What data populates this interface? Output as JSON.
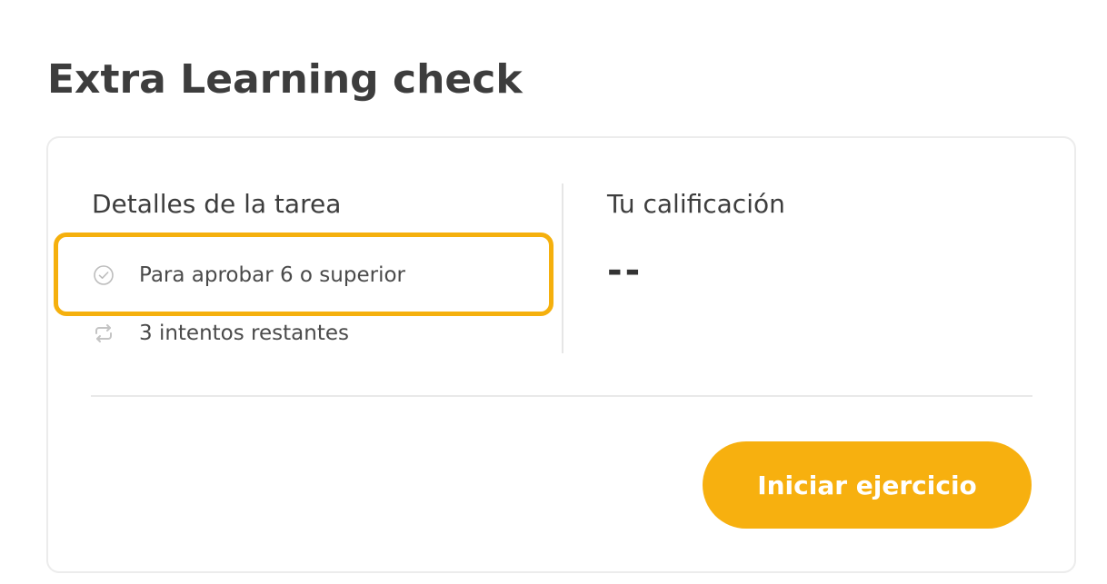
{
  "page": {
    "title": "Extra Learning check"
  },
  "details": {
    "heading": "Detalles de la tarea",
    "items": [
      {
        "icon": "check-circle-icon",
        "text": "Para aprobar 6 o superior"
      },
      {
        "icon": "repeat-icon",
        "text": "3 intentos restantes"
      }
    ]
  },
  "grade": {
    "heading": "Tu calificación",
    "value": "--"
  },
  "actions": {
    "start_label": "Iniciar ejercicio"
  },
  "colors": {
    "accent": "#f7b00f",
    "highlight": "#f5b00d",
    "icon": "#bdbdbd",
    "text": "#3d3d3d"
  }
}
